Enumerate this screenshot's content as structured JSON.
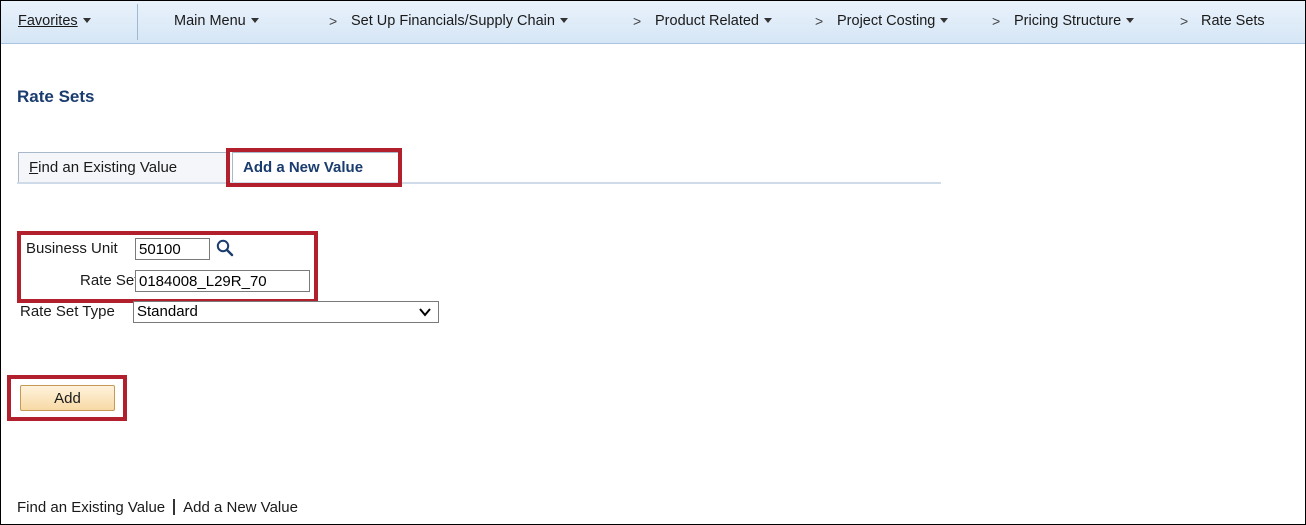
{
  "nav": {
    "favorites": "Favorites",
    "main_menu": "Main Menu",
    "separator": ">",
    "crumbs": [
      "Set Up Financials/Supply Chain",
      "Product Related",
      "Project Costing",
      "Pricing Structure",
      "Rate Sets"
    ]
  },
  "page": {
    "title": "Rate Sets"
  },
  "tabs": {
    "find_prefix": "F",
    "find_rest": "ind an Existing Value",
    "add_label": "Add a New Value"
  },
  "form": {
    "business_unit": {
      "label": "Business Unit",
      "value": "50100",
      "icon": "search-icon"
    },
    "rate_set": {
      "label": "Rate Set",
      "value": "0184008_L29R_70"
    },
    "rate_set_type": {
      "label": "Rate Set Type",
      "value": "Standard",
      "icon": "chevron-down-icon"
    }
  },
  "buttons": {
    "add": "Add"
  },
  "bottom_links": {
    "find": "Find an Existing Value",
    "add": "Add a New Value"
  },
  "colors": {
    "highlight": "#b21f2d",
    "title": "#1a3c6e",
    "navbar": "#d6e6f6",
    "button": "#f7d9a5"
  }
}
